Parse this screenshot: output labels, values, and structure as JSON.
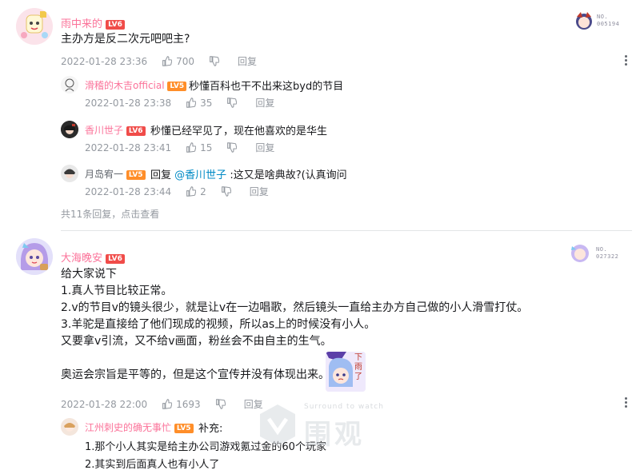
{
  "comments": [
    {
      "user": {
        "name": "雨中来的",
        "level": "LV6",
        "fan_no": "005194"
      },
      "text": "主办方是反二次元吧吧主?",
      "time": "2022-01-28 23:36",
      "likes": "700",
      "reply_label": "回复",
      "replies": [
        {
          "name": "滑稽的木吉official",
          "level": "LV5",
          "text": "秒懂百科也干不出来这byd的节目",
          "time": "2022-01-28 23:38",
          "likes": "35",
          "reply_label": "回复"
        },
        {
          "name": "香川世子",
          "level": "LV6",
          "text": "秒懂已经罕见了，现在他喜欢的是华生",
          "time": "2022-01-28 23:41",
          "likes": "15",
          "reply_label": "回复"
        },
        {
          "name": "月岛宥一",
          "level": "LV5",
          "prefix": "回复",
          "mention": "@香川世子",
          "text": ":这又是啥典故?(认真询问",
          "time": "2022-01-28 23:44",
          "likes": "2",
          "reply_label": "回复"
        }
      ],
      "more_replies": "共11条回复，点击查看"
    },
    {
      "user": {
        "name": "大海晚安",
        "level": "LV6",
        "fan_no": "027322"
      },
      "lines": [
        "给大家说下",
        "1.真人节目比较正常。",
        "2.v的节目v的镜头很少，就是让v在一边唱歌，然后镜头一直给主办方自己做的小人滑雪打仗。",
        "3.羊驼是直接给了他们现成的视频，所以as上的时候没有小人。",
        "又要拿v引流，又不给v画面，粉丝会不由自主的生气。",
        "",
        "奥运会宗旨是平等的，但是这个宣传并没有体现出来。"
      ],
      "time": "2022-01-28 22:00",
      "likes": "1693",
      "reply_label": "回复",
      "replies": [
        {
          "name": "江州刺史的确无事忙",
          "level": "LV5",
          "text": "补充:",
          "lines": [
            "1.那个小人其实是给主办公司游戏氪过金的60个玩家",
            "2.其实到后面真人也有小人了"
          ]
        }
      ]
    }
  ],
  "fan_label": "NO.",
  "sticker_text": "下雨了",
  "watermark": {
    "main": "围观",
    "sub": "Surround to watch"
  },
  "colors": {
    "pink": "#fb7299",
    "lv6": "#f04c49",
    "lv5": "#ff8e29",
    "link": "#008ac5",
    "meta": "#9499a0"
  }
}
